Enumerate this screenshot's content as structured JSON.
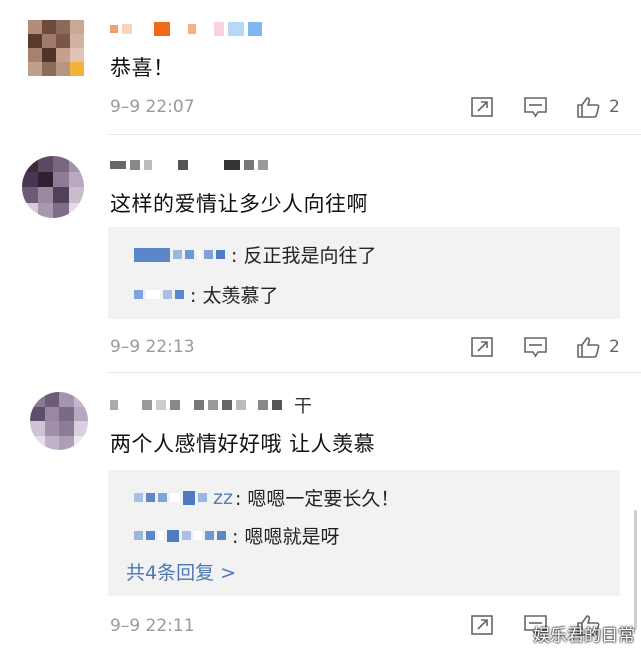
{
  "comments": [
    {
      "text": "恭喜！",
      "time": "9–9 22:07",
      "likes": "2",
      "avatar_colors": [
        "#b38c7a",
        "#6e4a3c",
        "#8a6a5c",
        "#c9a896",
        "#5a3a2e",
        "#9e7b6a",
        "#7b5546",
        "#d1b3a0",
        "#a98170",
        "#4f3228",
        "#c7a08b",
        "#e1c5b4",
        "#bfa08d",
        "#8f6b5a",
        "#b69682",
        "#f4b23a"
      ]
    },
    {
      "text": "这样的爱情让多少人向往啊",
      "time": "9–9 22:13",
      "likes": "2",
      "avatar_colors": [
        "#3b2b3a",
        "#5c4860",
        "#7b6680",
        "#a192a8",
        "#4a3650",
        "#2d2030",
        "#8e7c96",
        "#b9a9c0",
        "#6e5a74",
        "#9a88a0",
        "#52405a",
        "#c8bccd",
        "#d6ccd9",
        "#a898ad",
        "#7f6c86",
        "#e2dae4"
      ],
      "replies": [
        {
          "name": "",
          "text": ": 反正我是向往了"
        },
        {
          "name": "",
          "text": ": 太羡慕了"
        }
      ]
    },
    {
      "text": "两个人感情好好哦 让人羡慕",
      "name_tail": "干",
      "time": "9–9 22:11",
      "avatar_colors": [
        "#8a7a96",
        "#6c5c78",
        "#a494b0",
        "#c2b6cc",
        "#5e4e6a",
        "#9888a4",
        "#7a6a86",
        "#b6a8c0",
        "#cfc4d6",
        "#a090ac",
        "#8c7c98",
        "#d8cfe0",
        "#e4dde9",
        "#c0b3ca",
        "#ad9fb8",
        "#eee9f1"
      ],
      "replies": [
        {
          "name": "zz",
          "text": ": 嗯嗯一定要长久！"
        },
        {
          "name": "",
          "text": ": 嗯嗯就是呀"
        }
      ],
      "more_label": "共4条回复 >"
    }
  ],
  "watermark": "娱乐君的日常",
  "colors": {
    "accent_link": "#4e77b2",
    "reply_bg": "#f2f2f2",
    "meta_gray": "#9a9a9a"
  },
  "icons": [
    "forward-icon",
    "comment-icon",
    "like-icon"
  ]
}
